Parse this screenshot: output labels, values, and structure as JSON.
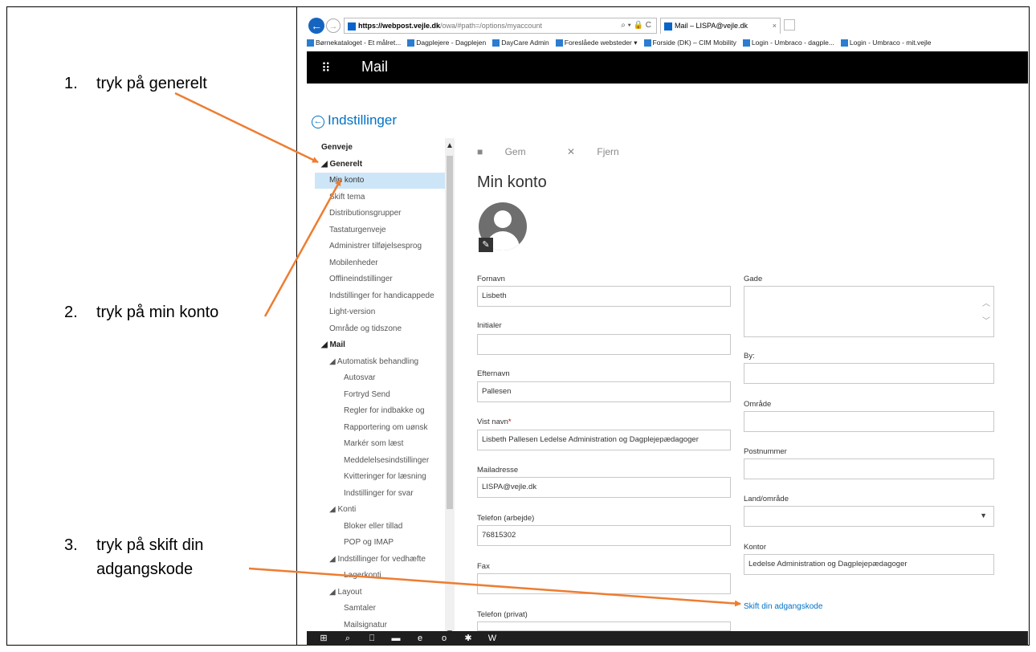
{
  "instructions": [
    {
      "num": "1.",
      "text": "tryk på generelt"
    },
    {
      "num": "2.",
      "text": "tryk på min konto"
    },
    {
      "num": "3.",
      "text": "tryk på skift din",
      "text2": "adgangskode"
    }
  ],
  "browser": {
    "url_host": "https://webpost.vejle.dk",
    "url_path": "/owa/#path=/options/myaccount",
    "url_icons": "⌕ ▾ 🔒 C",
    "tab_title": "Mail – LISPA@vejle.dk",
    "tab_close": "×",
    "favorites": [
      "Børnekataloget - Et målret...",
      "Dagplejere - Dagplejen",
      "DayCare Admin",
      "Foreslåede websteder ▾",
      "Forside (DK) – CIM Mobility",
      "Login - Umbraco - dagple...",
      "Login - Umbraco - mit.vejle"
    ]
  },
  "app": {
    "waffle_icon": "⠿",
    "name": "Mail"
  },
  "settings": {
    "back_icon": "←",
    "title": "Indstillinger"
  },
  "nav": [
    {
      "label": "Genveje",
      "level": 0,
      "bold": true
    },
    {
      "label": "◢ Generelt",
      "level": 0,
      "bold": true
    },
    {
      "label": "Min konto",
      "level": 1,
      "selected": true
    },
    {
      "label": "Skift tema",
      "level": 1
    },
    {
      "label": "Distributionsgrupper",
      "level": 1
    },
    {
      "label": "Tastaturgenveje",
      "level": 1
    },
    {
      "label": "Administrer tilføjelsesprog",
      "level": 1
    },
    {
      "label": "Mobilenheder",
      "level": 1
    },
    {
      "label": "Offlineindstillinger",
      "level": 1
    },
    {
      "label": "Indstillinger for handicappede",
      "level": 1
    },
    {
      "label": "Light-version",
      "level": 1
    },
    {
      "label": "Område og tidszone",
      "level": 1
    },
    {
      "label": "◢ Mail",
      "level": 0,
      "bold": true
    },
    {
      "label": "◢ Automatisk behandling",
      "level": 1
    },
    {
      "label": "Autosvar",
      "level": 2
    },
    {
      "label": "Fortryd Send",
      "level": 2
    },
    {
      "label": "Regler for indbakke og",
      "level": 2
    },
    {
      "label": "Rapportering om uønsk",
      "level": 2
    },
    {
      "label": "Markér som læst",
      "level": 2
    },
    {
      "label": "Meddelelsesindstillinger",
      "level": 2
    },
    {
      "label": "Kvitteringer for læsning",
      "level": 2
    },
    {
      "label": "Indstillinger for svar",
      "level": 2
    },
    {
      "label": "◢ Konti",
      "level": 1
    },
    {
      "label": "Bloker eller tillad",
      "level": 2
    },
    {
      "label": "POP og IMAP",
      "level": 2
    },
    {
      "label": "◢ Indstillinger for vedhæfte",
      "level": 1
    },
    {
      "label": "Lagerkonti",
      "level": 2
    },
    {
      "label": "◢ Layout",
      "level": 1
    },
    {
      "label": "Samtaler",
      "level": 2
    },
    {
      "label": "Mailsignatur",
      "level": 2
    }
  ],
  "scroll": {
    "up": "▲",
    "down": "▼"
  },
  "toolbar": {
    "save_icon": "■",
    "save_label": "Gem",
    "remove_icon": "✕",
    "remove_label": "Fjern"
  },
  "page_title": "Min konto",
  "avatar_edit_icon": "✎",
  "form": {
    "fornavn_label": "Fornavn",
    "fornavn_value": "Lisbeth",
    "initialer_label": "Initialer",
    "initialer_value": "",
    "efternavn_label": "Efternavn",
    "efternavn_value": "Pallesen",
    "vistnavn_label": "Vist navn",
    "vistnavn_req": "*",
    "vistnavn_value": "Lisbeth Pallesen  Ledelse Administration og Dagplejepædagoger",
    "mail_label": "Mailadresse",
    "mail_value": "LISPA@vejle.dk",
    "tlf_label": "Telefon (arbejde)",
    "tlf_value": "76815302",
    "fax_label": "Fax",
    "fax_value": "",
    "tlfpriv_label": "Telefon (privat)",
    "gade_label": "Gade",
    "by_label": "By:",
    "omraade_label": "Område",
    "postnr_label": "Postnummer",
    "land_label": "Land/område",
    "kontor_label": "Kontor",
    "kontor_value": "Ledelse Administration og Dagplejepædagoger",
    "textarea_up": "︿",
    "textarea_down": "﹀",
    "select_caret": "▼"
  },
  "password_link": "Skift din adgangskode",
  "taskbar": {
    "icons": [
      "⊞",
      "⌕",
      "⎕",
      "▬",
      "e",
      "o",
      "✱",
      "W"
    ]
  },
  "colors": {
    "accent": "#0072c6",
    "arrow": "#ed7d31",
    "header": "#000000",
    "selection": "#cde6f7"
  }
}
